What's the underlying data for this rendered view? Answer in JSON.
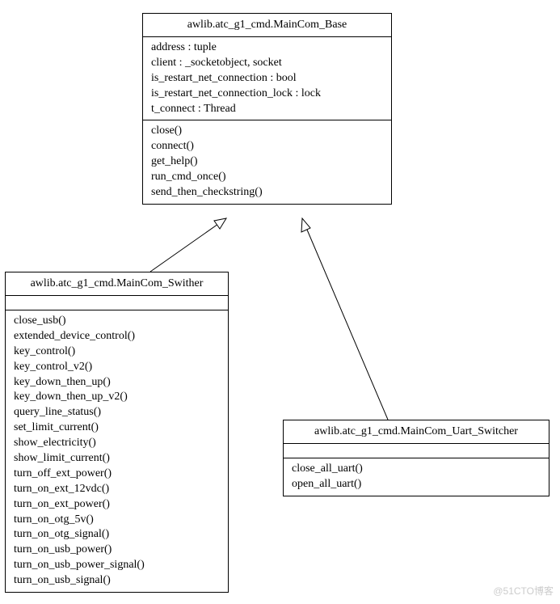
{
  "classes": {
    "base": {
      "title": "awlib.atc_g1_cmd.MainCom_Base",
      "attributes": [
        "address : tuple",
        "client : _socketobject, socket",
        "is_restart_net_connection : bool",
        "is_restart_net_connection_lock : lock",
        "t_connect : Thread"
      ],
      "methods": [
        "close()",
        "connect()",
        "get_help()",
        "run_cmd_once()",
        "send_then_checkstring()"
      ]
    },
    "swither": {
      "title": "awlib.atc_g1_cmd.MainCom_Swither",
      "attributes": [],
      "methods": [
        "close_usb()",
        "extended_device_control()",
        "key_control()",
        "key_control_v2()",
        "key_down_then_up()",
        "key_down_then_up_v2()",
        "query_line_status()",
        "set_limit_current()",
        "show_electricity()",
        "show_limit_current()",
        "turn_off_ext_power()",
        "turn_on_ext_12vdc()",
        "turn_on_ext_power()",
        "turn_on_otg_5v()",
        "turn_on_otg_signal()",
        "turn_on_usb_power()",
        "turn_on_usb_power_signal()",
        "turn_on_usb_signal()"
      ]
    },
    "uart": {
      "title": "awlib.atc_g1_cmd.MainCom_Uart_Switcher",
      "attributes": [],
      "methods": [
        "close_all_uart()",
        "open_all_uart()"
      ]
    }
  },
  "watermark": "@51CTO博客"
}
